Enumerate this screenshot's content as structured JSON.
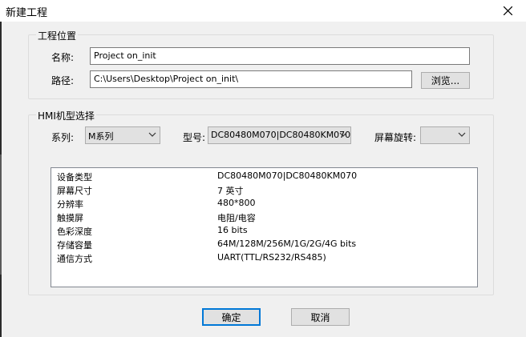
{
  "window": {
    "title": "新建工程"
  },
  "location_group": {
    "title": "工程位置",
    "name_label": "名称:",
    "name_value": "Project on_init",
    "path_label": "路径:",
    "path_value": "C:\\Users\\Desktop\\Project on_init\\",
    "browse_label": "浏览..."
  },
  "hmi_group": {
    "title": "HMI机型选择",
    "series_label": "系列:",
    "series_value": "M系列",
    "model_label": "型号:",
    "model_value": "DC80480M070|DC80480KM070",
    "rotation_label": "屏幕旋转:",
    "rotation_value": ""
  },
  "specs": [
    {
      "key": "设备类型",
      "value": "DC80480M070|DC80480KM070"
    },
    {
      "key": "屏幕尺寸",
      "value": "7 英寸"
    },
    {
      "key": "分辨率",
      "value": "480*800"
    },
    {
      "key": "触摸屏",
      "value": "电阻/电容"
    },
    {
      "key": "色彩深度",
      "value": "16 bits"
    },
    {
      "key": "存储容量",
      "value": "64M/128M/256M/1G/2G/4G bits"
    },
    {
      "key": "通信方式",
      "value": "UART(TTL/RS232/RS485)"
    }
  ],
  "buttons": {
    "ok": "确定",
    "cancel": "取消"
  },
  "icons": {
    "close": "close-icon",
    "dropdown": "chevron-down-icon"
  },
  "colors": {
    "default_button_border": "#0078d7",
    "background": "#f0f0f0"
  }
}
